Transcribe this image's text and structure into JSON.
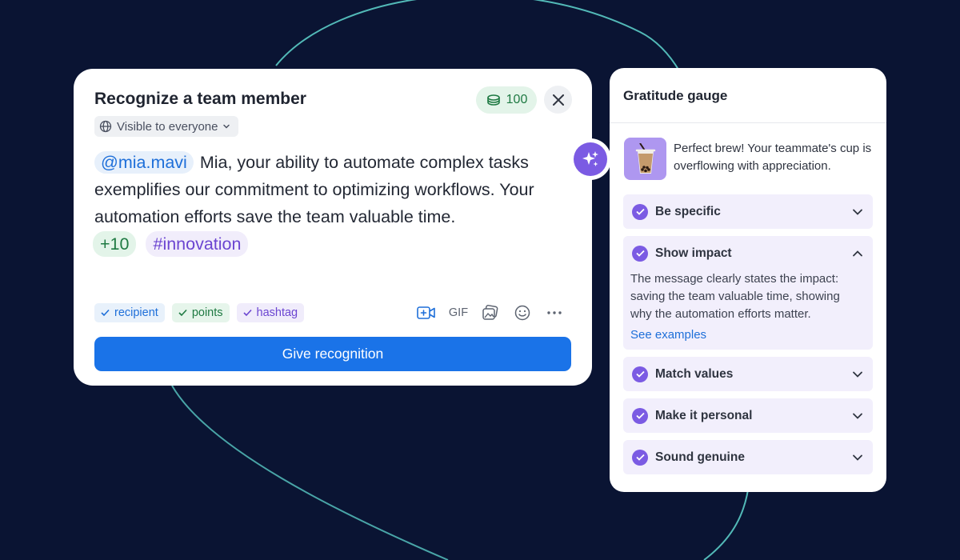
{
  "compose": {
    "title": "Recognize a team member",
    "points_balance": "100",
    "visibility": "Visible to everyone",
    "mention": "@mia.mavi",
    "message": "Mia, your ability to automate complex tasks exemplifies our commitment to optimizing workflows. Your automation efforts save the team valuable time.",
    "points_tag": "+10",
    "hashtag_tag": "#innovation",
    "chips": {
      "recipient": "recipient",
      "points": "points",
      "hashtag": "hashtag"
    },
    "toolbar": {
      "gif": "GIF"
    },
    "submit_label": "Give recognition"
  },
  "gauge": {
    "title": "Gratitude gauge",
    "summary": "Perfect brew! Your teammate's cup is overflowing with appreciation.",
    "criteria": [
      {
        "label": "Be specific",
        "expanded": false
      },
      {
        "label": "Show impact",
        "expanded": true,
        "detail": "The message clearly states the impact: saving the team valuable time, showing why the automation efforts matter.",
        "link": "See examples"
      },
      {
        "label": "Match values",
        "expanded": false
      },
      {
        "label": "Make it personal",
        "expanded": false
      },
      {
        "label": "Sound genuine",
        "expanded": false
      }
    ]
  },
  "colors": {
    "background": "#0a1433",
    "primary_button": "#1a73e8",
    "accent_purple": "#7b5be3",
    "points_green": "#1f7a43",
    "mention_blue": "#1e6fd9"
  },
  "icons": {
    "points": "coins-icon",
    "close": "close-icon",
    "visibility": "globe-icon",
    "dropdown": "chevron-down-icon",
    "video": "video-add-icon",
    "image": "image-gallery-icon",
    "emoji": "smiley-icon",
    "more": "more-dots-icon",
    "ai": "sparkles-icon",
    "brew": "bubble-tea-icon",
    "criterion_check": "check-circle-icon"
  }
}
